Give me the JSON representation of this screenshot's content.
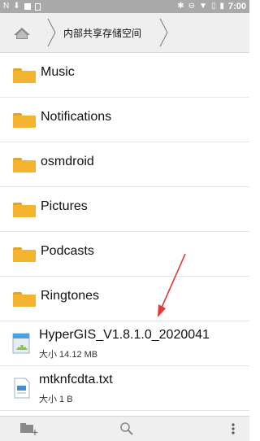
{
  "status_bar": {
    "time": "7:00",
    "icons": [
      "n-notification-icon",
      "download-icon",
      "square-icon",
      "sd-card-icon",
      "bluetooth-icon",
      "dnd-icon",
      "wifi-icon",
      "sim-icon",
      "battery-icon"
    ]
  },
  "breadcrumb": {
    "home_icon": "home-icon",
    "current": "内部共享存储空间"
  },
  "folders": [
    {
      "name": "Music"
    },
    {
      "name": "Notifications"
    },
    {
      "name": "osmdroid"
    },
    {
      "name": "Pictures"
    },
    {
      "name": "Podcasts"
    },
    {
      "name": "Ringtones"
    }
  ],
  "files": [
    {
      "name": "HyperGIS_V1.8.1.0_2020041",
      "size": "大小 14.12 MB",
      "icon": "apk-file-icon"
    },
    {
      "name": "mtknfcdta.txt",
      "size": "大小 1 B",
      "icon": "text-file-icon"
    }
  ],
  "toolbar": {
    "icons": [
      "new-folder-icon",
      "search-icon",
      "more-options-icon"
    ]
  },
  "colors": {
    "status_bar": "#a9a9a9",
    "folder": "#f4b42f",
    "annotation_arrow": "#e53935"
  }
}
